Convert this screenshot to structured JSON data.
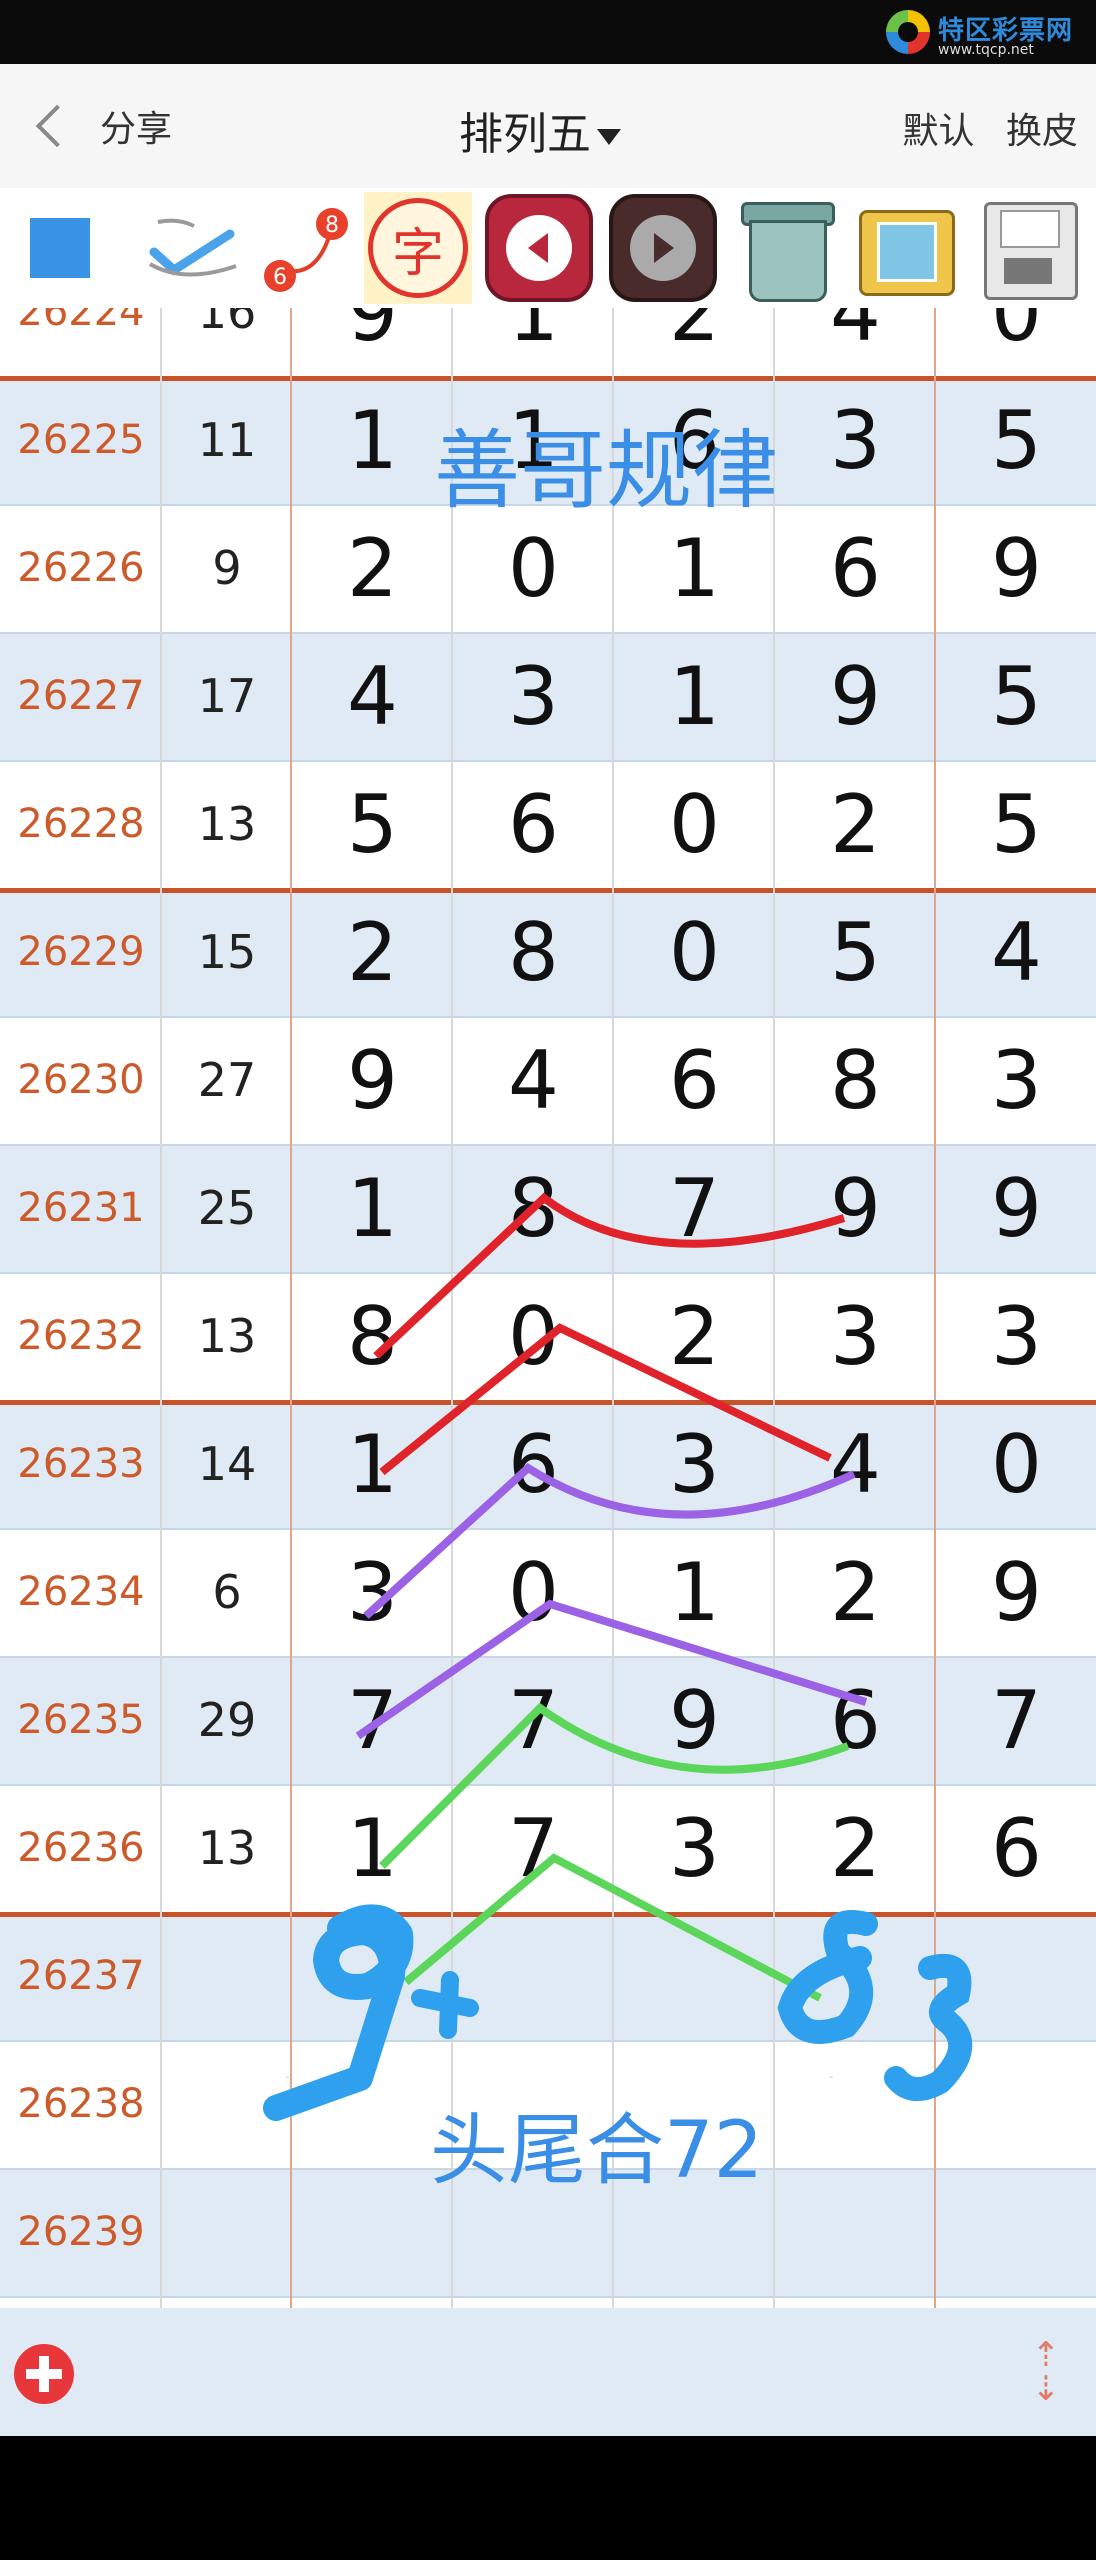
{
  "logo": {
    "name": "特区彩票网",
    "url": "www.tqcp.net"
  },
  "header": {
    "back_label": "分享",
    "title": "排列五",
    "actions": [
      "默认",
      "换皮"
    ]
  },
  "toolbar": {
    "icons": [
      "color-square-icon",
      "pen-check-icon",
      "connect-line-icon",
      "character-icon",
      "undo-arrow-icon",
      "redo-arrow-icon",
      "trash-icon",
      "photo-icon",
      "save-floppy-icon"
    ],
    "connect_label_top": "8",
    "connect_label_bottom": "6",
    "character_label": "字"
  },
  "table": {
    "rows": [
      {
        "issue": "26224",
        "sum": "16",
        "digits": [
          "9",
          "1",
          "2",
          "4",
          "0"
        ]
      },
      {
        "issue": "26225",
        "sum": "11",
        "digits": [
          "1",
          "1",
          "6",
          "3",
          "5"
        ]
      },
      {
        "issue": "26226",
        "sum": "9",
        "digits": [
          "2",
          "0",
          "1",
          "6",
          "9"
        ]
      },
      {
        "issue": "26227",
        "sum": "17",
        "digits": [
          "4",
          "3",
          "1",
          "9",
          "5"
        ]
      },
      {
        "issue": "26228",
        "sum": "13",
        "digits": [
          "5",
          "6",
          "0",
          "2",
          "5"
        ]
      },
      {
        "issue": "26229",
        "sum": "15",
        "digits": [
          "2",
          "8",
          "0",
          "5",
          "4"
        ]
      },
      {
        "issue": "26230",
        "sum": "27",
        "digits": [
          "9",
          "4",
          "6",
          "8",
          "3"
        ]
      },
      {
        "issue": "26231",
        "sum": "25",
        "digits": [
          "1",
          "8",
          "7",
          "9",
          "9"
        ]
      },
      {
        "issue": "26232",
        "sum": "13",
        "digits": [
          "8",
          "0",
          "2",
          "3",
          "3"
        ]
      },
      {
        "issue": "26233",
        "sum": "14",
        "digits": [
          "1",
          "6",
          "3",
          "4",
          "0"
        ]
      },
      {
        "issue": "26234",
        "sum": "6",
        "digits": [
          "3",
          "0",
          "1",
          "2",
          "9"
        ]
      },
      {
        "issue": "26235",
        "sum": "29",
        "digits": [
          "7",
          "7",
          "9",
          "6",
          "7"
        ]
      },
      {
        "issue": "26236",
        "sum": "13",
        "digits": [
          "1",
          "7",
          "3",
          "2",
          "6"
        ]
      },
      {
        "issue": "26237",
        "sum": "",
        "digits": [
          "",
          "",
          "",
          "",
          ""
        ]
      },
      {
        "issue": "26238",
        "sum": "",
        "digits": [
          "",
          "",
          "",
          "",
          ""
        ]
      },
      {
        "issue": "26239",
        "sum": "",
        "digits": [
          "",
          "",
          "",
          "",
          ""
        ]
      }
    ]
  },
  "annotations": {
    "title_text": "善哥规律",
    "bottom_text": "头尾合72",
    "handwritten_left": "94",
    "handwritten_right": "83",
    "colors": {
      "red": "#e0232b",
      "purple": "#9b62e6",
      "green": "#5cd65a",
      "blue": "#2ea0ee"
    }
  },
  "bottom": {
    "add_icon": "add-circle-icon",
    "scroll_icon": "scroll-arrows-icon"
  }
}
